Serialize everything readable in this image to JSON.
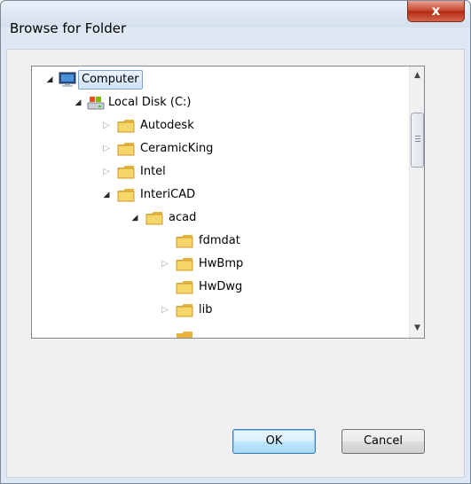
{
  "window": {
    "title": "Browse for Folder",
    "close_label": "x"
  },
  "tree": {
    "items": [
      {
        "label": "Computer",
        "icon": "computer-icon",
        "expander": "open",
        "selected": true
      },
      {
        "label": "Local Disk (C:)",
        "icon": "drive-icon",
        "expander": "open"
      },
      {
        "label": "Autodesk",
        "icon": "folder-icon",
        "expander": "closed"
      },
      {
        "label": "CeramicKing",
        "icon": "folder-icon",
        "expander": "closed"
      },
      {
        "label": "Intel",
        "icon": "folder-icon",
        "expander": "closed"
      },
      {
        "label": "InteriCAD",
        "icon": "folder-icon",
        "expander": "open"
      },
      {
        "label": "acad",
        "icon": "folder-icon",
        "expander": "open"
      },
      {
        "label": "fdmdat",
        "icon": "folder-icon",
        "expander": "none"
      },
      {
        "label": "HwBmp",
        "icon": "folder-icon",
        "expander": "closed"
      },
      {
        "label": "HwDwg",
        "icon": "folder-icon",
        "expander": "none"
      },
      {
        "label": "lib",
        "icon": "folder-icon",
        "expander": "closed"
      }
    ]
  },
  "buttons": {
    "ok_label": "OK",
    "cancel_label": "Cancel"
  },
  "colors": {
    "selection": "#cfe3f8",
    "folder": "#f2c94c"
  }
}
